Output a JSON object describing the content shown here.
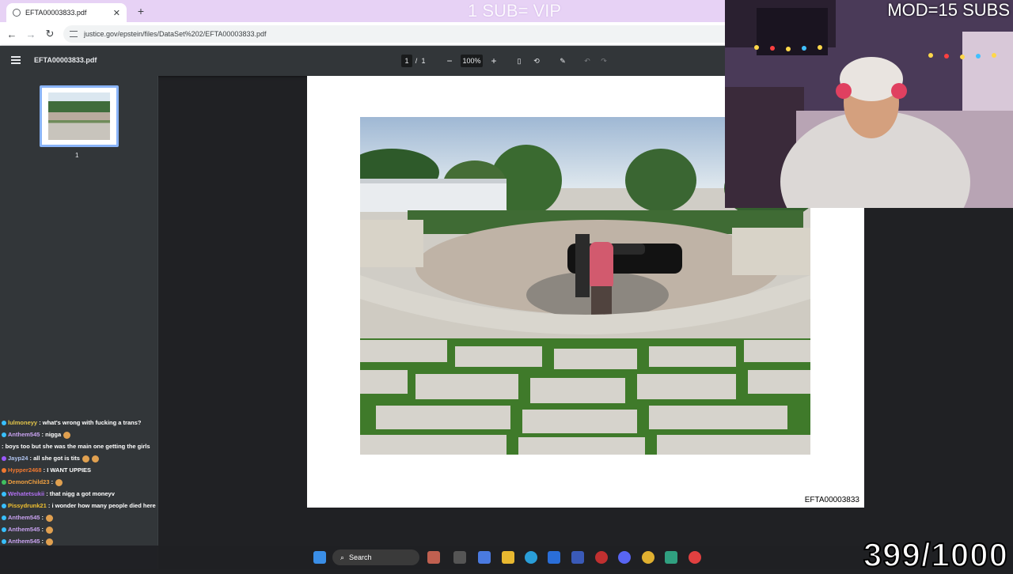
{
  "browser": {
    "tab_title": "EFTA00003833.pdf",
    "url": "justice.gov/epstein/files/DataSet%202/EFTA00003833.pdf"
  },
  "overlay": {
    "vip_text": "1 SUB= VIP",
    "mod_text": "MOD=15 SUBS",
    "counter": "399/1000"
  },
  "pdf": {
    "title": "EFTA00003833.pdf",
    "page_current": "1",
    "page_sep": "/",
    "page_total": "1",
    "zoom": "100%",
    "thumb_label": "1",
    "doc_id": "EFTA00003833"
  },
  "chat": [
    {
      "user": "lulmoneyy",
      "color": "#e3c54a",
      "msg": ": what's wrong with fucking a trans?"
    },
    {
      "user": "Anthem545",
      "color": "#c8a2f0",
      "msg": ": nigga"
    },
    {
      "user": "",
      "color": "#a01010",
      "msg": ": boys too but she was the main one getting the girls"
    },
    {
      "user": "Jayp24",
      "color": "#b0c4f0",
      "msg": ": all she got is tits"
    },
    {
      "user": "Hypper2468",
      "color": "#f07830",
      "msg": ": I WANT UPPIES"
    },
    {
      "user": "DemonChild23",
      "color": "#f0a040",
      "msg": ":"
    },
    {
      "user": "Wehatetsukii",
      "color": "#b070f0",
      "msg": ": that nigg a got moneyv"
    },
    {
      "user": "Pissydrunk21",
      "color": "#f0c030",
      "msg": ": i wonder how many people died here"
    },
    {
      "user": "Anthem545",
      "color": "#c8a2f0",
      "msg": ":"
    },
    {
      "user": "Anthem545",
      "color": "#c8a2f0",
      "msg": ":"
    },
    {
      "user": "Anthem545",
      "color": "#c8a2f0",
      "msg": ":"
    }
  ],
  "taskbar": {
    "search_label": "Search"
  }
}
